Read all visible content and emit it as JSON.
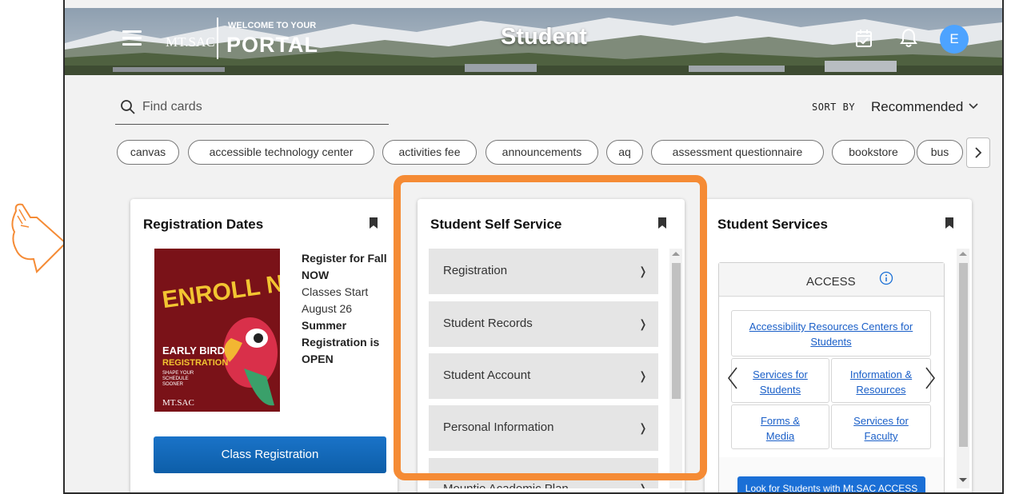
{
  "header": {
    "logo_text": "MT.SAC",
    "welcome_text": "WELCOME TO YOUR",
    "portal_text": "PORTAL",
    "page_title": "Student",
    "avatar_initial": "E",
    "icons": [
      "menu-icon",
      "calendar-check-icon",
      "bell-icon"
    ]
  },
  "search": {
    "placeholder": "Find cards",
    "value": ""
  },
  "sort": {
    "label": "SORT BY",
    "value": "Recommended"
  },
  "chips": [
    "canvas",
    "accessible technology center",
    "activities fee",
    "announcements",
    "aq",
    "assessment questionnaire",
    "bookstore",
    "bus"
  ],
  "cards": {
    "registration_dates": {
      "title": "Registration Dates",
      "poster": {
        "headline": "ENROLL NOW",
        "line1": "EARLY BIRD",
        "line2": "REGISTRATION",
        "line3": "SHAPE YOUR",
        "line4": "SCHEDULE",
        "line5": "SOONER",
        "logo": "MT.SAC"
      },
      "text": {
        "bold1": "Register for Fall NOW",
        "normal1": "Classes Start August 26",
        "bold2": "Summer Registration is OPEN"
      },
      "button": "Class Registration"
    },
    "student_self_service": {
      "title": "Student Self Service",
      "items": [
        "Registration",
        "Student Records",
        "Student Account",
        "Personal Information",
        "Mountie Academic Plan"
      ]
    },
    "student_services": {
      "title": "Student Services",
      "access_title": "ACCESS",
      "links": {
        "accessibility": "Accessibility Resources Centers for Students",
        "services_students": "Services for Students",
        "info_resources": "Information & Resources",
        "forms_media": "Forms & Media",
        "services_faculty": "Services for Faculty"
      },
      "bottom_button": "Look for Students with Mt.SAC ACCESS"
    }
  },
  "colors": {
    "highlight": "#f58b35",
    "primary_button": "#1a73c8",
    "avatar": "#4da3ff",
    "link": "#1a5fc8",
    "poster_bg": "#7a1218"
  }
}
